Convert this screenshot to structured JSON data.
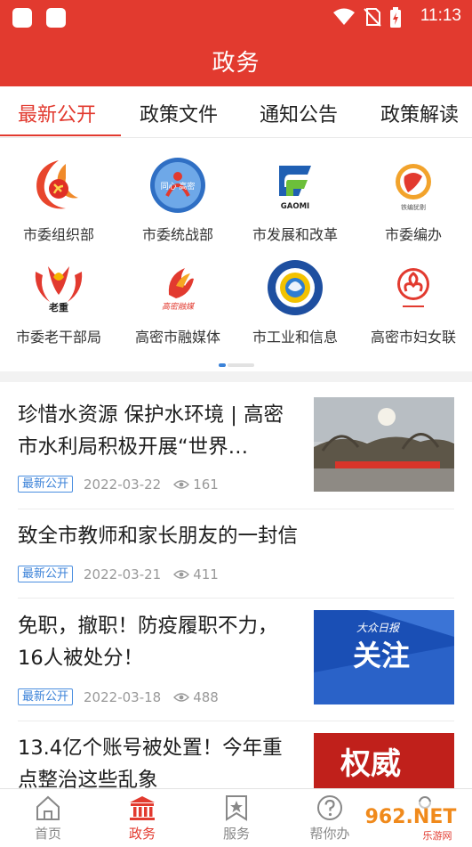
{
  "status_bar": {
    "time": "11:13"
  },
  "header": {
    "title": "政务"
  },
  "tabs": [
    {
      "label": "最新公开",
      "active": true
    },
    {
      "label": "政策文件",
      "active": false
    },
    {
      "label": "通知公告",
      "active": false
    },
    {
      "label": "政策解读",
      "active": false
    }
  ],
  "departments": [
    {
      "label": "市委组织部",
      "icon": "party-emblem-icon"
    },
    {
      "label": "市委统战部",
      "icon": "united-front-logo",
      "logo_text": "同心 高密"
    },
    {
      "label": "市发展和改革",
      "icon": "gaomi-development-logo",
      "logo_text": "GAOMI"
    },
    {
      "label": "市委编办",
      "icon": "establishment-office-logo",
      "logo_text": "铁编犹剔"
    },
    {
      "label": "市委老干部局",
      "icon": "veteran-cadres-logo",
      "logo_text": "老重"
    },
    {
      "label": "高密市融媒体",
      "icon": "gaomi-media-logo",
      "logo_text": "高密融媒"
    },
    {
      "label": "市工业和信息",
      "icon": "industry-information-logo"
    },
    {
      "label": "高密市妇女联",
      "icon": "women-federation-logo"
    }
  ],
  "news": [
    {
      "title": "珍惜水资源 保护水环境 | 高密市水利局积极开展“世界…",
      "badge": "最新公开",
      "date": "2022-03-22",
      "views": "161",
      "thumb": "park-scene"
    },
    {
      "title": "致全市教师和家长朋友的一封信",
      "badge": "最新公开",
      "date": "2022-03-21",
      "views": "411"
    },
    {
      "title": "免职，撤职！防疫履职不力，16人被处分！",
      "badge": "最新公开",
      "date": "2022-03-18",
      "views": "488",
      "thumb": "dazhong-attention",
      "thumb_caption": "大众日报",
      "thumb_word": "关注"
    },
    {
      "title": "13.4亿个账号被处置！今年重点整治这些乱象",
      "thumb": "authority-red",
      "thumb_word": "权威"
    }
  ],
  "bottom_nav": [
    {
      "label": "首页",
      "active": false
    },
    {
      "label": "政务",
      "active": true
    },
    {
      "label": "服务",
      "active": false
    },
    {
      "label": "帮你办",
      "active": false
    }
  ],
  "watermark": {
    "text": "962.NET",
    "sub": "乐游网"
  },
  "colors": {
    "brand": "#e23a2f",
    "badge_blue": "#3b82d8",
    "meta_gray": "#999999"
  }
}
